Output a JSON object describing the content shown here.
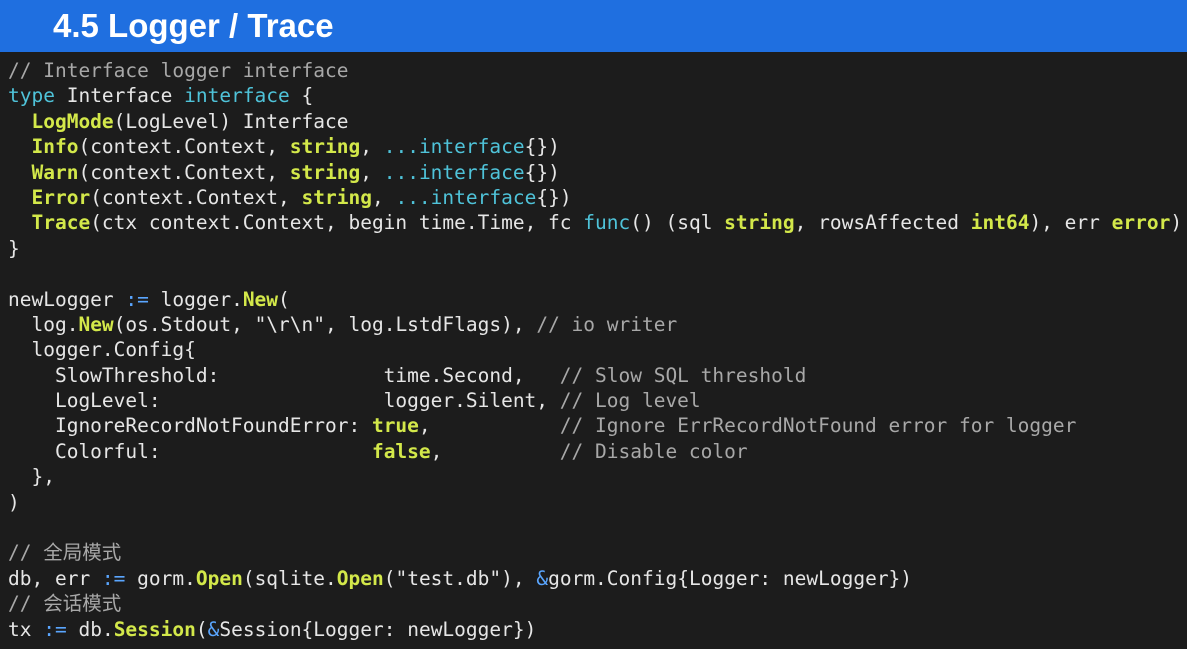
{
  "header": {
    "title": "4.5 Logger / Trace"
  },
  "colors": {
    "header_bg": "#1f6fe0",
    "code_bg": "#1c1c1c",
    "keyword": "#4fc3d9",
    "func": "#d3e84a",
    "comment": "#a8a8a8",
    "operator": "#5aa6ff"
  },
  "code": {
    "lines": [
      [
        {
          "t": "// Interface logger interface",
          "k": "comment"
        }
      ],
      [
        {
          "t": "type",
          "k": "keyword"
        },
        {
          "t": " Interface ",
          "k": "text"
        },
        {
          "t": "interface",
          "k": "keyword"
        },
        {
          "t": " {",
          "k": "text"
        }
      ],
      [
        {
          "t": "  ",
          "k": "text"
        },
        {
          "t": "LogMode",
          "k": "func"
        },
        {
          "t": "(LogLevel) Interface",
          "k": "text"
        }
      ],
      [
        {
          "t": "  ",
          "k": "text"
        },
        {
          "t": "Info",
          "k": "func"
        },
        {
          "t": "(context.Context, ",
          "k": "text"
        },
        {
          "t": "string",
          "k": "type"
        },
        {
          "t": ", ",
          "k": "text"
        },
        {
          "t": "...interface",
          "k": "keyword"
        },
        {
          "t": "{})",
          "k": "text"
        }
      ],
      [
        {
          "t": "  ",
          "k": "text"
        },
        {
          "t": "Warn",
          "k": "func"
        },
        {
          "t": "(context.Context, ",
          "k": "text"
        },
        {
          "t": "string",
          "k": "type"
        },
        {
          "t": ", ",
          "k": "text"
        },
        {
          "t": "...interface",
          "k": "keyword"
        },
        {
          "t": "{})",
          "k": "text"
        }
      ],
      [
        {
          "t": "  ",
          "k": "text"
        },
        {
          "t": "Error",
          "k": "func"
        },
        {
          "t": "(context.Context, ",
          "k": "text"
        },
        {
          "t": "string",
          "k": "type"
        },
        {
          "t": ", ",
          "k": "text"
        },
        {
          "t": "...interface",
          "k": "keyword"
        },
        {
          "t": "{})",
          "k": "text"
        }
      ],
      [
        {
          "t": "  ",
          "k": "text"
        },
        {
          "t": "Trace",
          "k": "func"
        },
        {
          "t": "(ctx context.Context, begin time.Time, fc ",
          "k": "text"
        },
        {
          "t": "func",
          "k": "keyword"
        },
        {
          "t": "() (sql ",
          "k": "text"
        },
        {
          "t": "string",
          "k": "type"
        },
        {
          "t": ", rowsAffected ",
          "k": "text"
        },
        {
          "t": "int64",
          "k": "type"
        },
        {
          "t": "), err ",
          "k": "text"
        },
        {
          "t": "error",
          "k": "type"
        },
        {
          "t": ")",
          "k": "text"
        }
      ],
      [
        {
          "t": "}",
          "k": "text"
        }
      ],
      [
        {
          "t": "",
          "k": "text"
        }
      ],
      [
        {
          "t": "newLogger ",
          "k": "text"
        },
        {
          "t": ":=",
          "k": "op"
        },
        {
          "t": " logger.",
          "k": "text"
        },
        {
          "t": "New",
          "k": "func"
        },
        {
          "t": "(",
          "k": "text"
        }
      ],
      [
        {
          "t": "  log.",
          "k": "text"
        },
        {
          "t": "New",
          "k": "func"
        },
        {
          "t": "(os.Stdout, \"\\r\\n\", log.LstdFlags), ",
          "k": "text"
        },
        {
          "t": "// io writer",
          "k": "comment"
        }
      ],
      [
        {
          "t": "  logger.Config{",
          "k": "text"
        }
      ],
      [
        {
          "t": "    SlowThreshold:              time.Second,   ",
          "k": "text"
        },
        {
          "t": "// Slow SQL threshold",
          "k": "comment"
        }
      ],
      [
        {
          "t": "    LogLevel:                   logger.Silent, ",
          "k": "text"
        },
        {
          "t": "// Log level",
          "k": "comment"
        }
      ],
      [
        {
          "t": "    IgnoreRecordNotFoundError: ",
          "k": "text"
        },
        {
          "t": "true",
          "k": "type"
        },
        {
          "t": ",           ",
          "k": "text"
        },
        {
          "t": "// Ignore ErrRecordNotFound error for logger",
          "k": "comment"
        }
      ],
      [
        {
          "t": "    Colorful:                  ",
          "k": "text"
        },
        {
          "t": "false",
          "k": "type"
        },
        {
          "t": ",          ",
          "k": "text"
        },
        {
          "t": "// Disable color",
          "k": "comment"
        }
      ],
      [
        {
          "t": "  },",
          "k": "text"
        }
      ],
      [
        {
          "t": ")",
          "k": "text"
        }
      ],
      [
        {
          "t": "",
          "k": "text"
        }
      ],
      [
        {
          "t": "// 全局模式",
          "k": "comment"
        }
      ],
      [
        {
          "t": "db, err ",
          "k": "text"
        },
        {
          "t": ":=",
          "k": "op"
        },
        {
          "t": " gorm.",
          "k": "text"
        },
        {
          "t": "Open",
          "k": "func"
        },
        {
          "t": "(sqlite.",
          "k": "text"
        },
        {
          "t": "Open",
          "k": "func"
        },
        {
          "t": "(\"test.db\"), ",
          "k": "text"
        },
        {
          "t": "&",
          "k": "op"
        },
        {
          "t": "gorm.Config{Logger: newLogger})",
          "k": "text"
        }
      ],
      [
        {
          "t": "// 会话模式",
          "k": "comment"
        }
      ],
      [
        {
          "t": "tx ",
          "k": "text"
        },
        {
          "t": ":=",
          "k": "op"
        },
        {
          "t": " db.",
          "k": "text"
        },
        {
          "t": "Session",
          "k": "func"
        },
        {
          "t": "(",
          "k": "text"
        },
        {
          "t": "&",
          "k": "op"
        },
        {
          "t": "Session{Logger: newLogger})",
          "k": "text"
        }
      ]
    ]
  }
}
